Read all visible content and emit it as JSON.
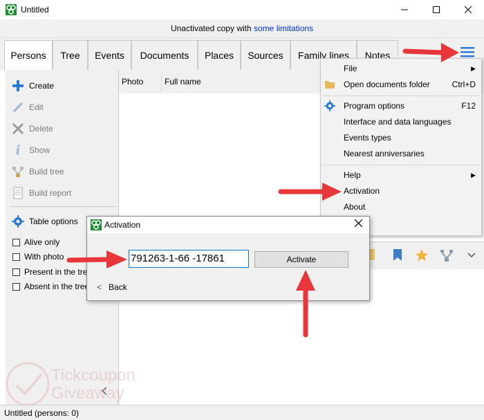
{
  "window": {
    "title": "Untitled"
  },
  "notice": {
    "prefix": "Unactivated copy with ",
    "link": "some limitations"
  },
  "tabs": [
    "Persons",
    "Tree",
    "Events",
    "Documents",
    "Places",
    "Sources",
    "Family lines",
    "Notes"
  ],
  "actions": [
    {
      "label": "Create",
      "icon": "plus-icon",
      "enabled": true
    },
    {
      "label": "Edit",
      "icon": "pencil-icon",
      "enabled": false
    },
    {
      "label": "Delete",
      "icon": "x-icon",
      "enabled": false
    },
    {
      "label": "Show",
      "icon": "info-icon",
      "enabled": false
    },
    {
      "label": "Build tree",
      "icon": "tree-icon",
      "enabled": false
    },
    {
      "label": "Build report",
      "icon": "report-icon",
      "enabled": false
    }
  ],
  "table_options": {
    "label": "Table options",
    "icon": "gear-icon"
  },
  "filters": [
    "Alive only",
    "With photo",
    "Present in the tree",
    "Absent in the tree"
  ],
  "columns": [
    "Photo",
    "Full name"
  ],
  "menu": {
    "items": [
      {
        "label": "File",
        "shortcut": "",
        "submenu": true,
        "icon": ""
      },
      {
        "label": "Open documents folder",
        "shortcut": "Ctrl+D",
        "submenu": false,
        "icon": "folder-icon"
      },
      {
        "label": "Program options",
        "shortcut": "F12",
        "submenu": false,
        "icon": "gear-icon"
      },
      {
        "label": "Interface and data languages",
        "shortcut": "",
        "submenu": false,
        "icon": ""
      },
      {
        "label": "Events types",
        "shortcut": "",
        "submenu": false,
        "icon": ""
      },
      {
        "label": "Nearest anniversaries",
        "shortcut": "",
        "submenu": false,
        "icon": ""
      },
      {
        "label": "Help",
        "shortcut": "",
        "submenu": true,
        "icon": ""
      },
      {
        "label": "Activation",
        "shortcut": "",
        "submenu": false,
        "icon": ""
      },
      {
        "label": "About",
        "shortcut": "",
        "submenu": false,
        "icon": ""
      }
    ]
  },
  "dialog": {
    "title": "Activation",
    "code_value": "791263-1-66    -17861",
    "activate_label": "Activate",
    "back_label": "Back"
  },
  "status": {
    "text": "Untitled (persons: 0)"
  },
  "watermark": {
    "line1": "Tickcoupon",
    "line2": "Giveaway"
  },
  "colors": {
    "accent": "#0078d7",
    "arrow": "#e8373a",
    "link": "#0033cc",
    "icon_blue": "#2a7ad2"
  }
}
